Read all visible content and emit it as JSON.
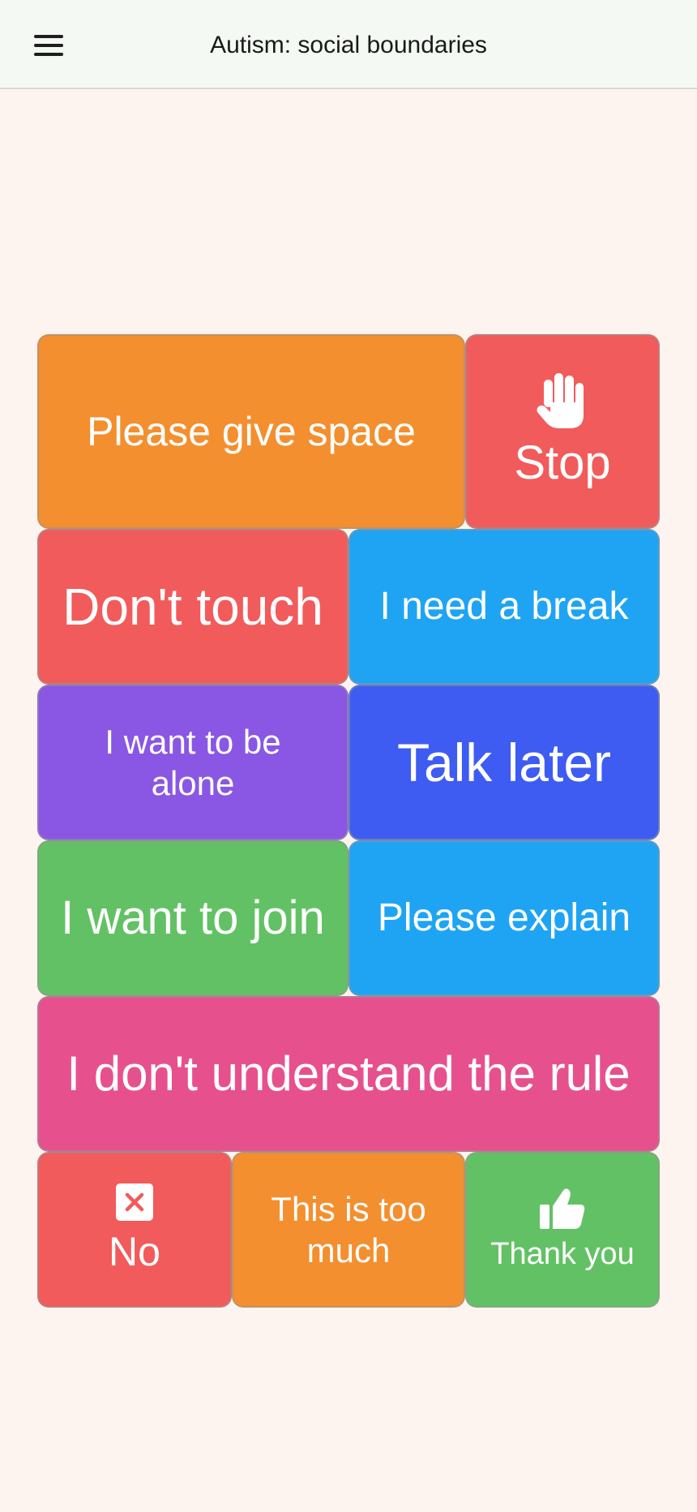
{
  "header": {
    "title": "Autism: social boundaries",
    "menu_icon": "hamburger-menu-icon"
  },
  "tiles": {
    "give_space": {
      "label": "Please give space",
      "color": "#f38f2f"
    },
    "stop": {
      "label": "Stop",
      "icon": "raised-hand-icon",
      "color": "#f25b5b"
    },
    "dont_touch": {
      "label": "Don't touch",
      "color": "#f25b5b"
    },
    "need_break": {
      "label": "I need a break",
      "color": "#1fa4f3"
    },
    "be_alone": {
      "label": "I want to be alone",
      "color": "#8957e3"
    },
    "talk_later": {
      "label": "Talk later",
      "color": "#3e5cf2"
    },
    "want_join": {
      "label": "I want to join",
      "color": "#63c165"
    },
    "please_explain": {
      "label": "Please explain",
      "color": "#1fa4f3"
    },
    "dont_understand": {
      "label": "I don't understand the rule",
      "color": "#e6518d"
    },
    "no": {
      "label": "No",
      "icon": "x-box-icon",
      "color": "#f25b5b"
    },
    "too_much": {
      "label": "This is too much",
      "color": "#f38f2f"
    },
    "thank_you": {
      "label": "Thank you",
      "icon": "thumbs-up-icon",
      "color": "#63c165"
    }
  }
}
